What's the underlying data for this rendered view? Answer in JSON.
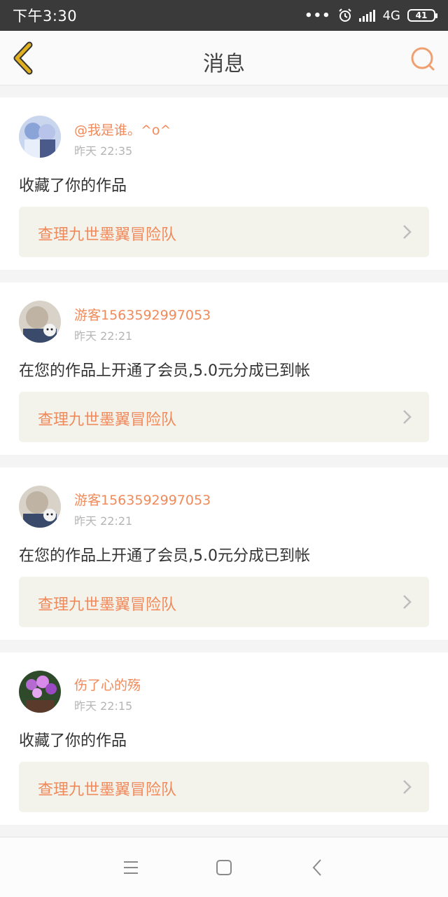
{
  "status_bar": {
    "time": "下午3:30",
    "dots": "•••",
    "network": "4G",
    "battery": "41"
  },
  "header": {
    "title": "消息",
    "back_icon": "chevron-left-icon",
    "search_icon": "search-icon"
  },
  "colors": {
    "accent": "#f08a5a",
    "back_arrow": "#e0b020",
    "card_link_bg": "#f3f3ec"
  },
  "notifications": [
    {
      "username": "@我是谁。^o^",
      "time": "昨天 22:35",
      "message": "收藏了你的作品",
      "work": "查理九世墨翼冒险队"
    },
    {
      "username": "游客1563592997053",
      "time": "昨天 22:21",
      "message": "在您的作品上开通了会员,5.0元分成已到帐",
      "work": "查理九世墨翼冒险队"
    },
    {
      "username": "游客1563592997053",
      "time": "昨天 22:21",
      "message": "在您的作品上开通了会员,5.0元分成已到帐",
      "work": "查理九世墨翼冒险队"
    },
    {
      "username": "伤了心的殇",
      "time": "昨天 22:15",
      "message": "收藏了你的作品",
      "work": "查理九世墨翼冒险队"
    }
  ],
  "system_nav": {
    "menu_icon": "menu-icon",
    "home_icon": "home-square-icon",
    "back_icon": "back-triangle-icon"
  }
}
